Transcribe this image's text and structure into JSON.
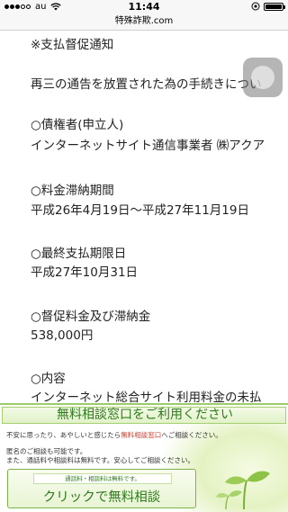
{
  "status_bar": {
    "carrier": "au",
    "time": "11:44",
    "battery_level": 1.0
  },
  "url_bar": {
    "title": "特殊詐欺.com"
  },
  "content": {
    "notice_heading": "※支払督促通知",
    "notice_body": "再三の通告を放置された為の手続きについ",
    "creditor_label": "○債権者(申立人)",
    "creditor_value": "インターネットサイト通信事業者 ㈱アクア",
    "period_label": "○料金滞納期間",
    "period_value": "平成26年4月19日～平成27年11月19日",
    "deadline_label": "○最終支払期限日",
    "deadline_value": "平成27年10月31日",
    "amount_label": "○督促料金及び滞納金",
    "amount_value": "538,000円",
    "detail_label": "○内容",
    "detail_value": "インターネット総合サイト利用料金の未払"
  },
  "banner": {
    "title": "無料相談窓口をご利用ください",
    "line1_prefix": "不安に思ったり、あやしいと感じたら",
    "line1_highlight": "無料相談窓口",
    "line1_suffix": "へご相談ください。",
    "line2": "匿名のご相談も可能です。",
    "line3": "また、通話料や相談料は無料です。安心してご相談ください。",
    "cta_sub": "通話料・相談料は無料です。",
    "cta_main": "クリックで無料相談"
  }
}
